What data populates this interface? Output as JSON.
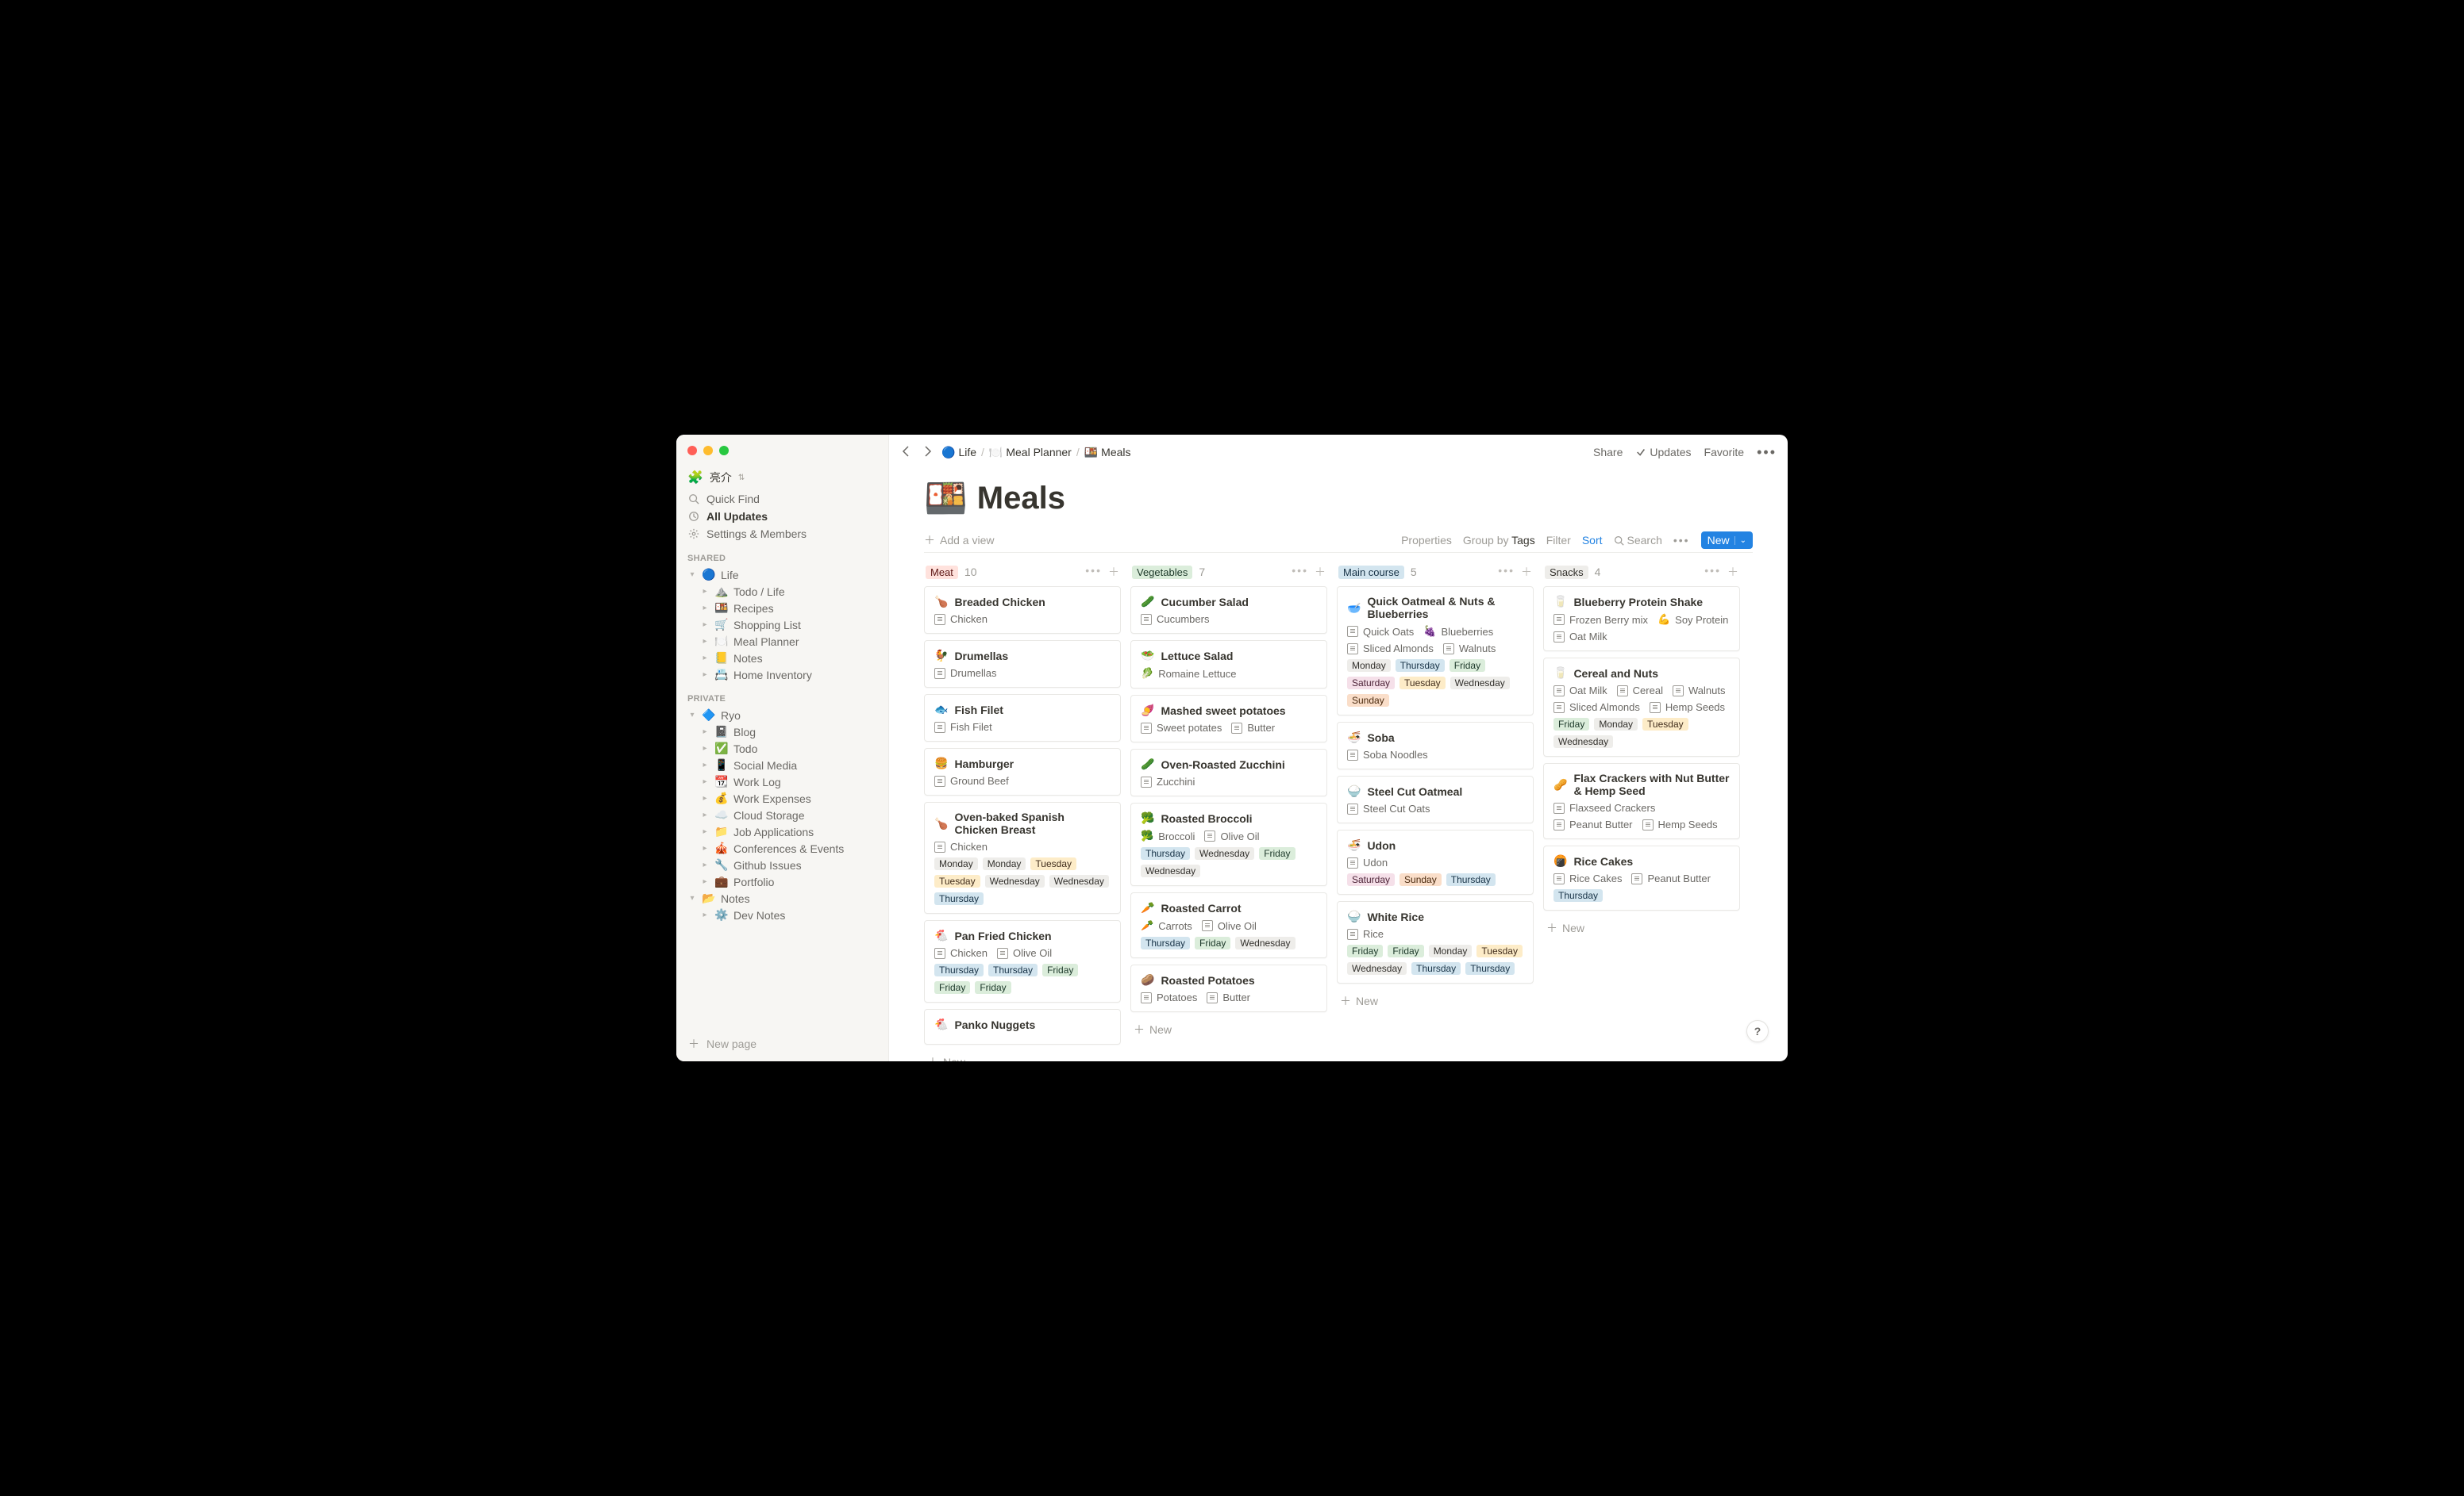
{
  "sidebar": {
    "user_name": "亮介",
    "quick_find": "Quick Find",
    "all_updates": "All Updates",
    "settings": "Settings & Members",
    "section_shared": "SHARED",
    "section_private": "PRIVATE",
    "shared_root": {
      "icon": "🔵",
      "label": "Life"
    },
    "shared_items": [
      {
        "icon": "⛰️",
        "label": "Todo / Life"
      },
      {
        "icon": "🍱",
        "label": "Recipes"
      },
      {
        "icon": "🛒",
        "label": "Shopping List"
      },
      {
        "icon": "🍽️",
        "label": "Meal Planner"
      },
      {
        "icon": "📒",
        "label": "Notes"
      },
      {
        "icon": "📇",
        "label": "Home Inventory"
      }
    ],
    "private_root": {
      "icon": "🔷",
      "label": "Ryo"
    },
    "private_items": [
      {
        "icon": "📓",
        "label": "Blog"
      },
      {
        "icon": "✅",
        "label": "Todo"
      },
      {
        "icon": "📱",
        "label": "Social Media"
      },
      {
        "icon": "📆",
        "label": "Work Log"
      },
      {
        "icon": "💰",
        "label": "Work Expenses"
      },
      {
        "icon": "☁️",
        "label": "Cloud Storage"
      },
      {
        "icon": "📁",
        "label": "Job Applications"
      },
      {
        "icon": "🎪",
        "label": "Conferences & Events"
      },
      {
        "icon": "🔧",
        "label": "Github Issues"
      },
      {
        "icon": "💼",
        "label": "Portfolio"
      }
    ],
    "notes_root": {
      "icon": "📂",
      "label": "Notes"
    },
    "notes_items": [
      {
        "icon": "⚙️",
        "label": "Dev Notes"
      }
    ],
    "new_page": "New page"
  },
  "topbar": {
    "crumbs": [
      {
        "icon": "🔵",
        "label": "Life"
      },
      {
        "icon": "🍽️",
        "label": "Meal Planner"
      },
      {
        "icon": "🍱",
        "label": "Meals"
      }
    ],
    "share": "Share",
    "updates": "Updates",
    "favorite": "Favorite"
  },
  "page": {
    "emoji": "🍱",
    "title": "Meals",
    "add_view": "Add a view",
    "ctrl_properties": "Properties",
    "ctrl_groupby_prefix": "Group by",
    "ctrl_groupby_value": "Tags",
    "ctrl_filter": "Filter",
    "ctrl_sort": "Sort",
    "ctrl_search": "Search",
    "ctrl_new": "New"
  },
  "new_label": "New",
  "help": "?",
  "day_colors": {
    "Monday": "t-default",
    "Tuesday": "t-yellow",
    "Wednesday": "t-default",
    "Thursday": "t-blue",
    "Friday": "t-green",
    "Saturday": "t-pink",
    "Sunday": "t-orange"
  },
  "columns": [
    {
      "id": "meat",
      "label": "Meat",
      "tag_color": "t-red",
      "count": 10,
      "show_actions": true,
      "cards": [
        {
          "emoji": "🍗",
          "title": "Breaded Chicken",
          "props": [
            {
              "icon": "page",
              "label": "Chicken"
            }
          ],
          "days": []
        },
        {
          "emoji": "🐓",
          "title": "Drumellas",
          "props": [
            {
              "icon": "page",
              "label": "Drumellas"
            }
          ],
          "days": []
        },
        {
          "emoji": "🐟",
          "title": "Fish Filet",
          "props": [
            {
              "icon": "page",
              "label": "Fish Filet"
            }
          ],
          "days": []
        },
        {
          "emoji": "🍔",
          "title": "Hamburger",
          "props": [
            {
              "icon": "page",
              "label": "Ground Beef"
            }
          ],
          "days": []
        },
        {
          "emoji": "🍗",
          "title": "Oven-baked Spanish Chicken Breast",
          "props": [
            {
              "icon": "page",
              "label": "Chicken"
            }
          ],
          "days": [
            "Monday",
            "Monday",
            "Tuesday",
            "Tuesday",
            "Wednesday",
            "Wednesday",
            "Thursday"
          ]
        },
        {
          "emoji": "🐔",
          "title": "Pan Fried Chicken",
          "props": [
            {
              "icon": "page",
              "label": "Chicken"
            },
            {
              "icon": "page",
              "label": "Olive Oil"
            }
          ],
          "days": [
            "Thursday",
            "Thursday",
            "Friday",
            "Friday",
            "Friday"
          ]
        },
        {
          "emoji": "🐔",
          "title": "Panko Nuggets",
          "props": [],
          "days": []
        }
      ]
    },
    {
      "id": "vegetables",
      "label": "Vegetables",
      "tag_color": "t-green",
      "count": 7,
      "show_actions": true,
      "cards": [
        {
          "emoji": "🥒",
          "title": "Cucumber Salad",
          "props": [
            {
              "icon": "page",
              "label": "Cucumbers"
            }
          ],
          "days": []
        },
        {
          "emoji": "🥗",
          "title": "Lettuce Salad",
          "props": [
            {
              "icon": "emoji",
              "emoji": "🥬",
              "label": "Romaine Lettuce"
            }
          ],
          "days": []
        },
        {
          "emoji": "🍠",
          "title": "Mashed sweet potatoes",
          "props": [
            {
              "icon": "page",
              "label": "Sweet potates"
            },
            {
              "icon": "page",
              "label": "Butter"
            }
          ],
          "days": []
        },
        {
          "emoji": "🥒",
          "title": "Oven-Roasted Zucchini",
          "props": [
            {
              "icon": "page",
              "label": "Zucchini"
            }
          ],
          "days": []
        },
        {
          "emoji": "🥦",
          "title": "Roasted Broccoli",
          "props": [
            {
              "icon": "emoji",
              "emoji": "🥦",
              "label": "Broccoli"
            },
            {
              "icon": "page",
              "label": "Olive Oil"
            }
          ],
          "days": [
            "Thursday",
            "Wednesday",
            "Friday",
            "Wednesday"
          ]
        },
        {
          "emoji": "🥕",
          "title": "Roasted Carrot",
          "props": [
            {
              "icon": "emoji",
              "emoji": "🥕",
              "label": "Carrots"
            },
            {
              "icon": "page",
              "label": "Olive Oil"
            }
          ],
          "days": [
            "Thursday",
            "Friday",
            "Wednesday"
          ]
        },
        {
          "emoji": "🥔",
          "title": "Roasted Potatoes",
          "props": [
            {
              "icon": "page",
              "label": "Potatoes"
            },
            {
              "icon": "page",
              "label": "Butter"
            }
          ],
          "days": []
        }
      ]
    },
    {
      "id": "maincourse",
      "label": "Main course",
      "tag_color": "t-blue",
      "count": 5,
      "show_actions": true,
      "cards": [
        {
          "emoji": "🥣",
          "title": "Quick Oatmeal & Nuts & Blueberries",
          "props": [
            {
              "icon": "page",
              "label": "Quick Oats"
            },
            {
              "icon": "emoji",
              "emoji": "🍇",
              "label": "Blueberries"
            },
            {
              "icon": "page",
              "label": "Sliced Almonds"
            },
            {
              "icon": "page",
              "label": "Walnuts"
            }
          ],
          "days": [
            "Monday",
            "Thursday",
            "Friday",
            "Saturday",
            "Tuesday",
            "Wednesday",
            "Sunday"
          ]
        },
        {
          "emoji": "🍜",
          "title": "Soba",
          "props": [
            {
              "icon": "page",
              "label": "Soba Noodles"
            }
          ],
          "days": []
        },
        {
          "emoji": "🍚",
          "title": "Steel Cut Oatmeal",
          "props": [
            {
              "icon": "page",
              "label": "Steel Cut Oats"
            }
          ],
          "days": []
        },
        {
          "emoji": "🍜",
          "title": "Udon",
          "props": [
            {
              "icon": "page",
              "label": "Udon"
            }
          ],
          "days": [
            "Saturday",
            "Sunday",
            "Thursday"
          ]
        },
        {
          "emoji": "🍚",
          "title": "White Rice",
          "props": [
            {
              "icon": "page",
              "label": "Rice"
            }
          ],
          "days": [
            "Friday",
            "Friday",
            "Monday",
            "Tuesday",
            "Wednesday",
            "Thursday",
            "Thursday"
          ]
        }
      ]
    },
    {
      "id": "snacks",
      "label": "Snacks",
      "tag_color": "t-default",
      "count": 4,
      "show_actions": true,
      "cards": [
        {
          "emoji": "🥛",
          "title": "Blueberry Protein Shake",
          "props": [
            {
              "icon": "page",
              "label": "Frozen Berry mix"
            },
            {
              "icon": "emoji",
              "emoji": "💪",
              "label": "Soy Protein"
            },
            {
              "icon": "page",
              "label": "Oat Milk"
            }
          ],
          "days": []
        },
        {
          "emoji": "🥛",
          "title": "Cereal and Nuts",
          "props": [
            {
              "icon": "page",
              "label": "Oat Milk"
            },
            {
              "icon": "page",
              "label": "Cereal"
            },
            {
              "icon": "page",
              "label": "Walnuts"
            },
            {
              "icon": "page",
              "label": "Sliced Almonds"
            },
            {
              "icon": "page",
              "label": "Hemp Seeds"
            }
          ],
          "days": [
            "Friday",
            "Monday",
            "Tuesday",
            "Wednesday"
          ]
        },
        {
          "emoji": "🥜",
          "title": "Flax Crackers with Nut Butter & Hemp Seed",
          "props": [
            {
              "icon": "page",
              "label": "Flaxseed Crackers"
            },
            {
              "icon": "page",
              "label": "Peanut Butter"
            },
            {
              "icon": "page",
              "label": "Hemp Seeds"
            }
          ],
          "days": []
        },
        {
          "emoji": "🍘",
          "title": "Rice Cakes",
          "props": [
            {
              "icon": "page",
              "label": "Rice Cakes"
            },
            {
              "icon": "page",
              "label": "Peanut Butter"
            }
          ],
          "days": [
            "Thursday"
          ]
        }
      ]
    }
  ]
}
